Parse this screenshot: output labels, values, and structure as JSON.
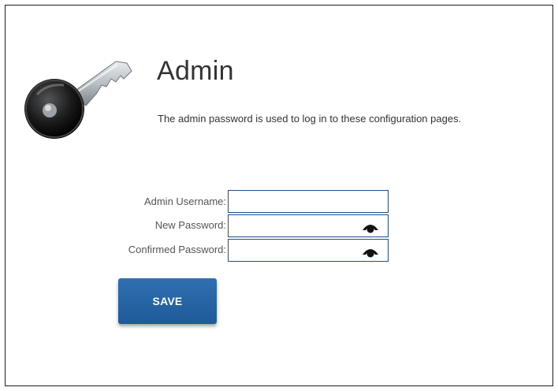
{
  "page": {
    "title": "Admin",
    "description": "The admin password is used to log in to these configuration pages."
  },
  "form": {
    "username_label": "Admin Username:",
    "username_value": "",
    "new_password_label": "New Password:",
    "new_password_value": "",
    "confirmed_password_label": "Confirmed Password:",
    "confirmed_password_value": "",
    "save_label": "SAVE"
  },
  "icons": {
    "logo": "key-icon",
    "password_toggle": "eye-icon"
  },
  "colors": {
    "input_border": "#1f4f8a",
    "button": "#2a66a6",
    "text": "#333333"
  }
}
